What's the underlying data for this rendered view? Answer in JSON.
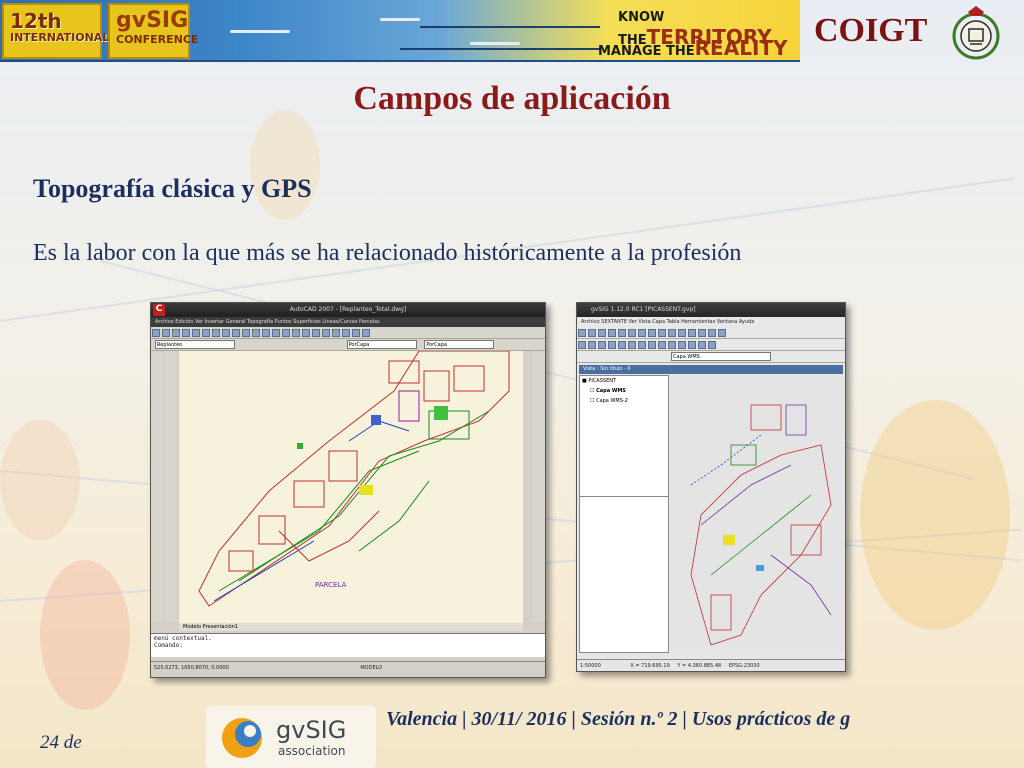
{
  "banner": {
    "badge_line1": "12th",
    "badge_line2": "INTERNATIONAL",
    "gvsig_line1": "gvSIG",
    "gvsig_line2": "CONFERENCE",
    "tagline_know": "KNOW THE",
    "tagline_territory": "TERRITORY",
    "tagline_manage": "MANAGE THE",
    "tagline_reality": "REALITY"
  },
  "org_name": "COIGT",
  "slide": {
    "title": "Campos de aplicación",
    "subtitle": "Topografía clásica y GPS",
    "body": "Es la labor con la que más se ha relacionado históricamente a la profesión"
  },
  "autocad": {
    "window_title": "AutoCAD 2007 - [Replanteo_Total.dwg]",
    "menu": "Archivo  Edición  Ver  Insertar  General  Topografía  Puntos  Superficies  Líneas/Curvas  Parcelas",
    "layer_value": "Replanteo",
    "color_value": "PorCapa",
    "linetype_value": "PorCapa",
    "tabs": "Modelo  Presentación1",
    "command_line1": "menú contextual.",
    "command_line2": "Comando:",
    "status_coords": "525.0273, 1050.8070, 0.0000",
    "status_mode": "MODELO"
  },
  "gvsig": {
    "window_title": "gvSIG 1.12.0 RC1 [PICASSENT.gvp]",
    "menu": "Archivo  SEXTANTE  Ver  Vista  Capa  Tabla  Herramientas  Ventana  Ayuda",
    "layer_combo": "Capa WMS",
    "view_title": "Vista : Sin título - 0",
    "toc_root": "PICASSENT",
    "toc_layer1": "Capa WMS",
    "toc_layer2": "Capa WMS-2",
    "status_scale": "1:50000",
    "status_x": "X = 719.695.19",
    "status_y": "Y = 4.360.885.48",
    "status_epsg": "EPSG:23030"
  },
  "footer": {
    "text": "Valencia | 30/11/ 2016 | Sesión n.º 2 | Usos prácticos de g",
    "logo_name": "gvSIG",
    "logo_sub": "association",
    "page": "24 de"
  },
  "colors": {
    "title": "#8b1a1a",
    "text": "#1b2f5e",
    "org": "#7a1414"
  },
  "icons": [
    "crest-icon",
    "gvsig-logo-icon",
    "plane-icon"
  ]
}
